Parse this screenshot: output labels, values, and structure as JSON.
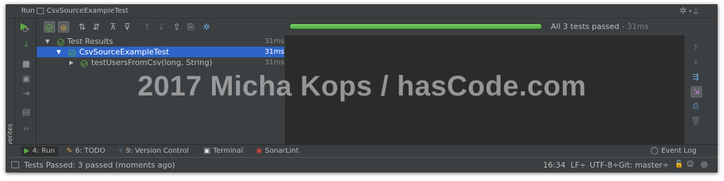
{
  "window": {
    "run_label": "Run",
    "config_name": "CsvSourceExampleTest"
  },
  "favorites": {
    "label": "2: Favorites"
  },
  "progress": {
    "fraction": 1.0,
    "status": "All 3 tests passed",
    "separator": " - ",
    "duration": "31ms"
  },
  "tree": {
    "rows": [
      {
        "label": "Test Results",
        "time": "31ms"
      },
      {
        "label": "CsvSourceExampleTest",
        "time": "31ms"
      },
      {
        "label": "testUsersFromCsv(long, String)",
        "time": "31ms"
      }
    ]
  },
  "toolwindows": [
    {
      "label": "4: Run"
    },
    {
      "label": "6: TODO"
    },
    {
      "label": "9: Version Control"
    },
    {
      "label": "Terminal"
    },
    {
      "label": "SonarLint"
    },
    {
      "label": "Event Log"
    }
  ],
  "statusbar": {
    "message": "Tests Passed: 3 passed (moments ago)",
    "position": "16:34",
    "line_sep": "LF÷",
    "encoding": "UTF-8÷",
    "vcs": "Git: master÷"
  },
  "watermark": "2017 Micha Kops / hasCode.com",
  "colors": {
    "accent": "#2f65ca",
    "success": "#5ea843",
    "background": "#3c3f41",
    "console": "#2b2b2b"
  },
  "icons": [
    "run-icon",
    "stop-icon",
    "rerun-failed-icon",
    "toggle-autotest-icon",
    "export-icon",
    "import-icon",
    "settings-icon",
    "gear-icon",
    "pin-icon",
    "star-icon",
    "event-log-icon",
    "sonarlint-icon",
    "terminal-icon",
    "todo-icon",
    "version-control-icon",
    "lock-icon",
    "person-icon"
  ]
}
